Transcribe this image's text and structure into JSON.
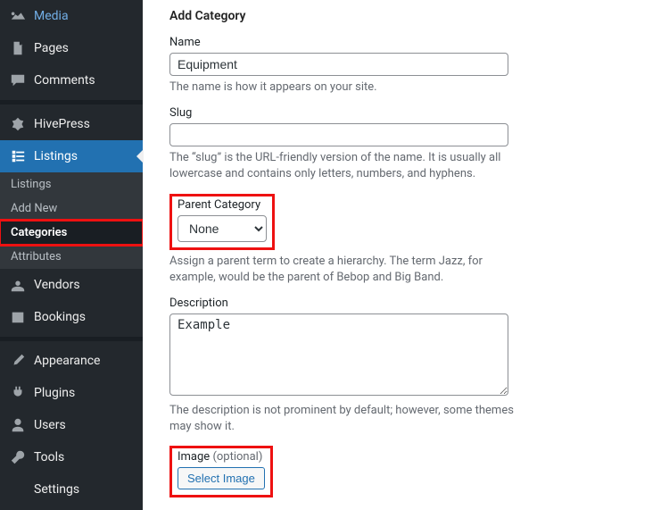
{
  "sidebar": {
    "media": "Media",
    "pages": "Pages",
    "comments": "Comments",
    "hivepress": "HivePress",
    "listings": "Listings",
    "listings_sub": "Listings",
    "addnew": "Add New",
    "categories": "Categories",
    "attributes": "Attributes",
    "vendors": "Vendors",
    "bookings": "Bookings",
    "appearance": "Appearance",
    "plugins": "Plugins",
    "users": "Users",
    "tools": "Tools",
    "settings": "Settings"
  },
  "form": {
    "heading": "Add Category",
    "name_label": "Name",
    "name_value": "Equipment",
    "name_desc": "The name is how it appears on your site.",
    "slug_label": "Slug",
    "slug_value": "",
    "slug_desc": "The “slug” is the URL-friendly version of the name. It is usually all lowercase and contains only letters, numbers, and hyphens.",
    "parent_label": "Parent Category",
    "parent_value": "None",
    "parent_desc": "Assign a parent term to create a hierarchy. The term Jazz, for example, would be the parent of Bebop and Big Band.",
    "desc_label": "Description",
    "desc_value": "Example",
    "desc_desc": "The description is not prominent by default; however, some themes may show it.",
    "image_label": "Image",
    "image_optional": "(optional)",
    "image_button": "Select Image"
  }
}
